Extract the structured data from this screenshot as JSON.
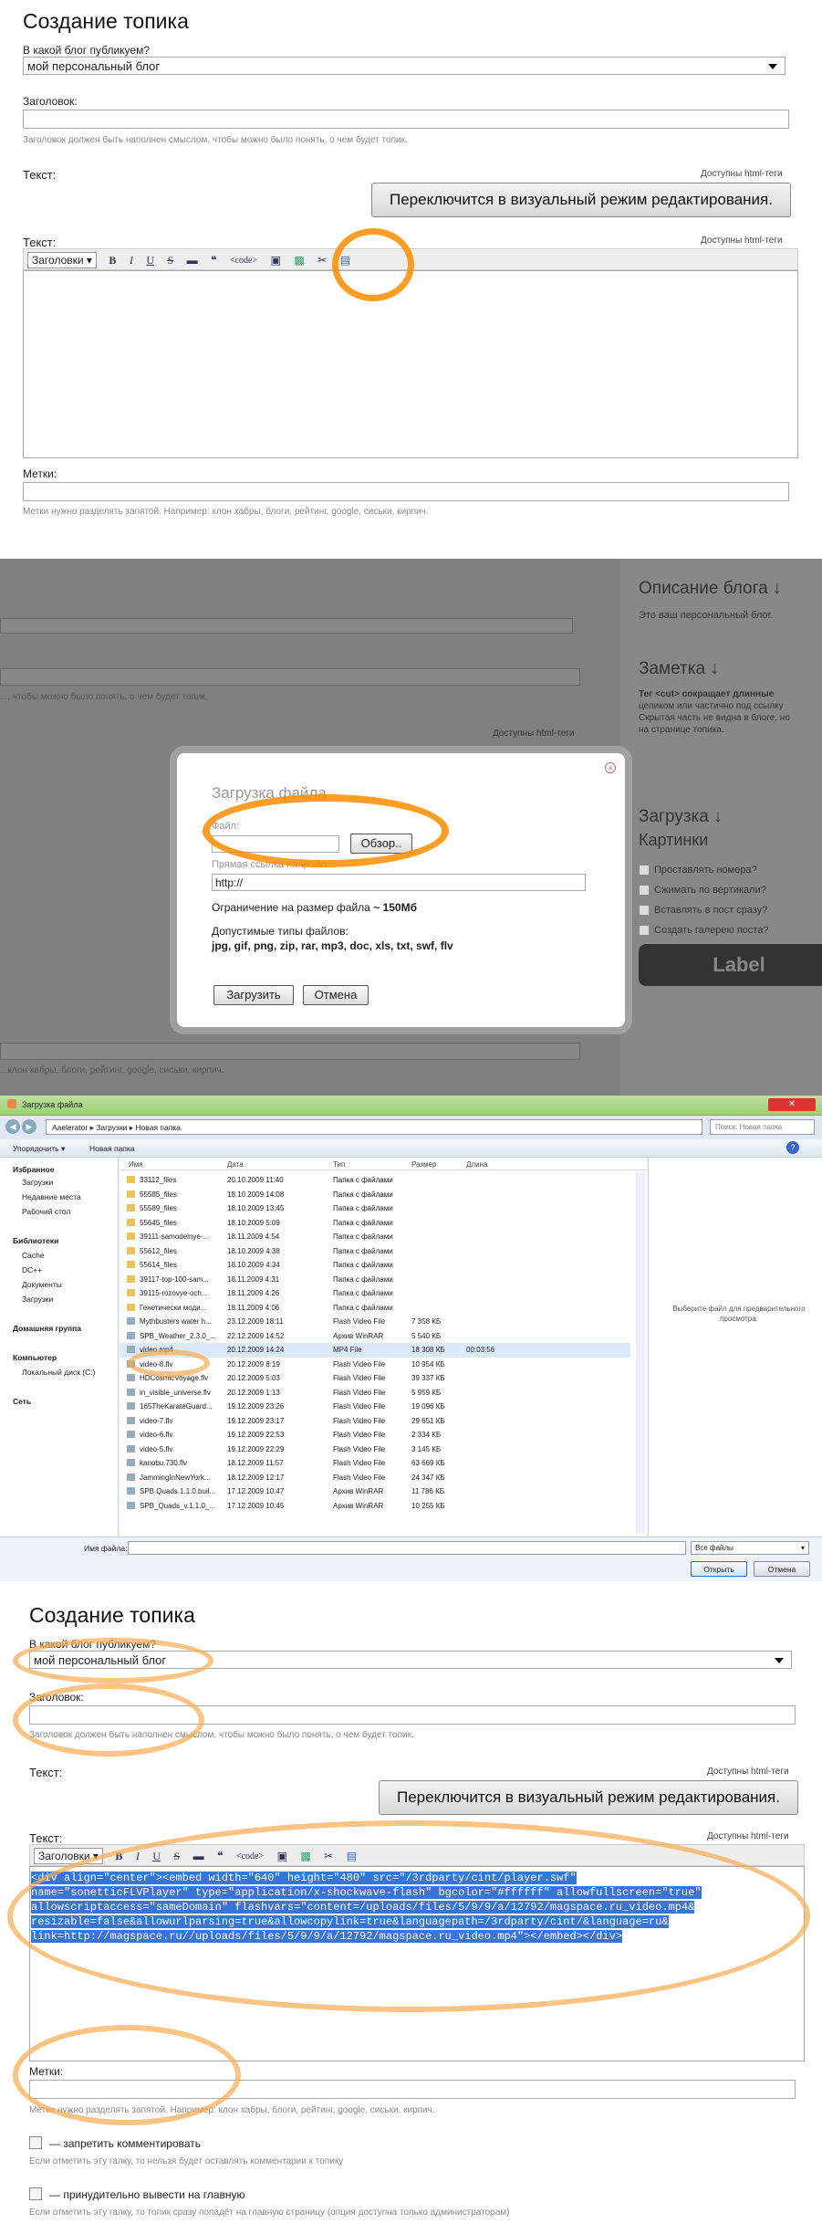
{
  "p1": {
    "title": "Создание топика",
    "blog_label": "В какой блог публикуем?",
    "blog_value": "мой персональный блог",
    "heading_label": "Заголовок:",
    "heading_hint": "Заголовок должен быть наполнен смыслом, чтобы можно было понять, о чем будет топик.",
    "text_label": "Текст:",
    "html_tags": "Доступны html-теги",
    "visual_button": "Переключится в визуальный режим редактирования.",
    "text_label2": "Текст:",
    "html_tags2": "Доступны html-теги",
    "toolbar": {
      "headings": "Заголовки",
      "bold": "B",
      "italic": "I",
      "underline": "U",
      "strike": "S",
      "code": "<code>"
    },
    "tags_label": "Метки:",
    "tags_hint": "Метки нужно разделять запятой. Например: клон хабры, блоги, рейтинг, google, сиськи, кирпич."
  },
  "p2": {
    "bg_html_tags": "Доступны html-теги",
    "bg_hint": "..., чтобы можно было понять, о чем будет топик.",
    "bg_tags_hint": "...клон хабры, блоги, рейтинг, google, сиськи, кирпич.",
    "side": {
      "blog_desc_title": "Описание блога ↓",
      "blog_desc_text": "Это ваш персональный блог.",
      "note_title": "Заметка ↓",
      "note_text_1": "Тег <cut> сокращает длинные",
      "note_text_2": "целиком или частично под ссылку",
      "note_text_3": "Скрытая часть не видна в блоге, но",
      "note_text_4": "на странице топика.",
      "upload_title": "Загрузка ↓",
      "images_title": "Картинки",
      "opt1": "Проставлять номера?",
      "opt2": "Сжимать по вертикали?",
      "opt3": "Вставлять в пост сразу?",
      "opt4": "Создать галерею поста?",
      "label_button": "Label"
    },
    "dialog": {
      "title": "Загрузка файла",
      "file_label": "Файл:",
      "browse": "Обзор..",
      "link_label": "Прямая ссылка на файл:",
      "url_value": "http://",
      "limit_prefix": "Ограничение на размер файла",
      "limit_value": "~ 150Мб",
      "types_label": "Допустимые типы файлов:",
      "types_value": "jpg, gif, png, zip, rar, mp3, doc, xls, txt, swf, flv",
      "upload_btn": "Загрузить",
      "cancel_btn": "Отмена"
    }
  },
  "p3": {
    "window_title": "Загрузка файла",
    "breadcrumb": [
      "Aaelerator",
      "Загрузки",
      "Новая папка"
    ],
    "search_placeholder": "Поиск: Новая папка",
    "organize": "Упорядочить ▾",
    "new_folder": "Новая папка",
    "columns": [
      "Имя",
      "Дата",
      "Тип",
      "Размер",
      "Длина"
    ],
    "nav": [
      "Избранное",
      "Загрузки",
      "Недавние места",
      "Рабочий стол",
      "Библиотеки",
      "Cache",
      "DC++",
      "Документы",
      "Загрузки",
      "Домашняя группа",
      "Компьютер",
      "Локальный диск (C:)",
      "Сеть"
    ],
    "files": [
      [
        "33112_files",
        "20.10.2009 11:40",
        "Папка с файлами",
        "",
        ""
      ],
      [
        "55585_files",
        "18.10.2009 14:08",
        "Папка с файлами",
        "",
        ""
      ],
      [
        "55589_files",
        "18.10.2009 13:45",
        "Папка с файлами",
        "",
        ""
      ],
      [
        "55645_files",
        "18.10.2009 5:09",
        "Папка с файлами",
        "",
        ""
      ],
      [
        "39111-samodelnye-...",
        "18.11.2009 4:54",
        "Папка с файлами",
        "",
        ""
      ],
      [
        "55612_files",
        "18.10.2009 4:38",
        "Папка с файлами",
        "",
        ""
      ],
      [
        "55614_files",
        "18.10.2009 4:34",
        "Папка с файлами",
        "",
        ""
      ],
      [
        "39117-top-100-sam...",
        "18.11.2009 4:31",
        "Папка с файлами",
        "",
        ""
      ],
      [
        "39115-rozovye-och...",
        "18.11.2009 4:26",
        "Папка с файлами",
        "",
        ""
      ],
      [
        "Генетически моди...",
        "18.11.2009 4:06",
        "Папка с файлами",
        "",
        ""
      ],
      [
        "Mythbusters water h...",
        "23.12.2009 18:11",
        "Flash Video File",
        "7 358 КБ",
        ""
      ],
      [
        "SPB_Weather_2.3.0_...",
        "22.12.2009 14:52",
        "Архив WinRAR",
        "5 540 КБ",
        ""
      ],
      [
        "video.mp4",
        "20.12.2009 14:24",
        "MP4 File",
        "18 308 КБ",
        "00:03:56"
      ],
      [
        "video-8.flv",
        "20.12.2009 8:19",
        "Flash Video File",
        "10 954 КБ",
        ""
      ],
      [
        "HDCosmicVoyage.flv",
        "20.12.2009 5:03",
        "Flash Video File",
        "39 337 КБ",
        ""
      ],
      [
        "in_visible_universe.flv",
        "20.12.2009 1:13",
        "Flash Video File",
        "5 959 КБ",
        ""
      ],
      [
        "165TheKarateGuard...",
        "19.12.2009 23:26",
        "Flash Video File",
        "19 096 КБ",
        ""
      ],
      [
        "video-7.flv",
        "19.12.2009 23:17",
        "Flash Video File",
        "29 651 КБ",
        ""
      ],
      [
        "video-6.flv",
        "19.12.2009 22:53",
        "Flash Video File",
        "2 334 КБ",
        ""
      ],
      [
        "video-5.flv",
        "19.12.2009 22:29",
        "Flash Video File",
        "3 145 КБ",
        ""
      ],
      [
        "kanobu.730.flv",
        "18.12.2009 11:57",
        "Flash Video File",
        "63 669 КБ",
        ""
      ],
      [
        "JammingInNewYork...",
        "18.12.2009 12:17",
        "Flash Video File",
        "24 347 КБ",
        ""
      ],
      [
        "SPB.Quads.1.1.0.buil...",
        "17.12.2009 10:47",
        "Архив WinRAR",
        "11 786 КБ",
        ""
      ],
      [
        "SPB_Quads_v.1.1.0_...",
        "17.12.2009 10:45",
        "Архив WinRAR",
        "10 255 КБ",
        ""
      ]
    ],
    "preview_text_1": "Выберите файл для предварительного",
    "preview_text_2": "просмотра.",
    "filename_label": "Имя файла:",
    "filter": "Все файлы",
    "open_btn": "Открыть",
    "cancel_btn": "Отмена"
  },
  "p4": {
    "title": "Создание топика",
    "blog_label": "В какой блог публикуем?",
    "blog_value": "мой персональный блог",
    "heading_label": "Заголовок:",
    "heading_hint": "Заголовок должен быть наполнен смыслом, чтобы можно было понять, о чем будет топик.",
    "text_label": "Текст:",
    "html_tags": "Доступны html-теги",
    "visual_button": "Переключится в визуальный режим редактирования.",
    "text_label2": "Текст:",
    "html_tags2": "Доступны html-теги",
    "toolbar": {
      "headings": "Заголовки",
      "bold": "B",
      "italic": "I",
      "underline": "U",
      "strike": "S",
      "code": "<code>"
    },
    "code_lines": [
      "<div align=\"center\"><embed width=\"640\" height=\"480\" src=\"/3rdparty/cint/player.swf\"",
      "name=\"sonetticFLVPlayer\" type=\"application/x-shockwave-flash\" bgcolor=\"#ffffff\" allowfullscreen=\"true\"",
      "allowscriptaccess=\"sameDomain\" flashvars=\"content=/uploads/files/5/9/9/a/12792/magspace.ru_video.mp4&",
      "resizable=false&allowurlparsing=true&allowcopylink=true&languagepath=/3rdparty/cint/&language=ru&",
      "link=http://magspace.ru//uploads/files/5/9/9/a/12792/magspace.ru_video.mp4\"></embed></div>"
    ],
    "tags_label": "Метки:",
    "tags_hint": "Метки нужно разделять запятой. Например: клон хабры, блоги, рейтинг, google, сиськи, кирпич.",
    "no_comments": "— запретить комментировать",
    "no_comments_hint": "Если отметить эту галку, то нельзя будет оставлять комментарии к топику",
    "to_main": "— принудительно вывести на главную",
    "to_main_hint": "Если отметить эту галку, то топик сразу попадёт на главную страницу (опция доступна только администраторам)"
  }
}
